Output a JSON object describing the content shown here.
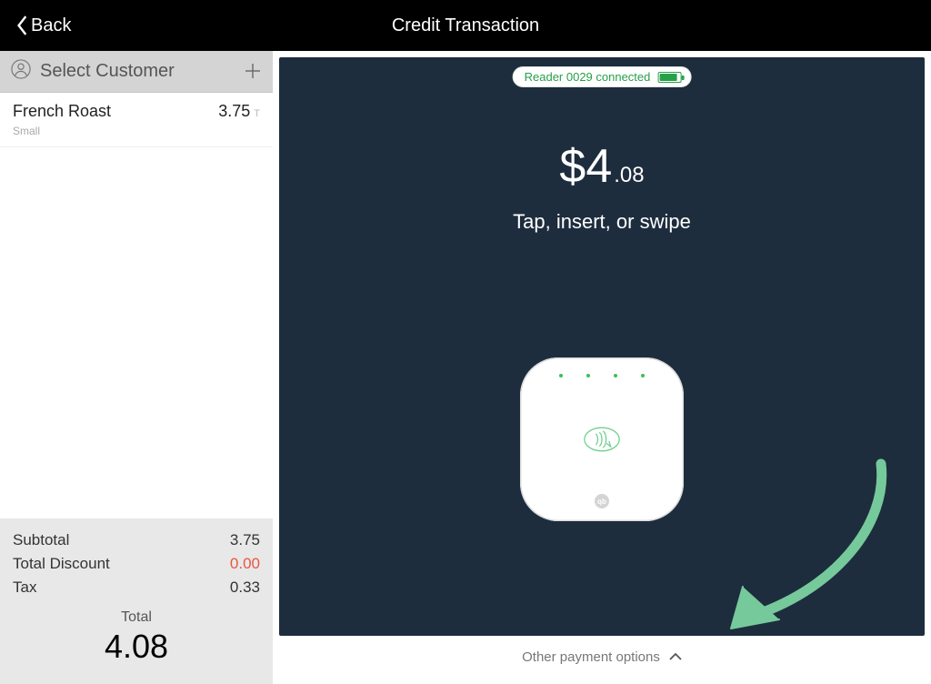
{
  "header": {
    "back_label": "Back",
    "title": "Credit Transaction"
  },
  "customer": {
    "select_label": "Select Customer"
  },
  "items": [
    {
      "name": "French Roast",
      "price": "3.75",
      "tax_flag": "T",
      "variant": "Small"
    }
  ],
  "totals": {
    "subtotal_label": "Subtotal",
    "subtotal_value": "3.75",
    "discount_label": "Total Discount",
    "discount_value": "0.00",
    "tax_label": "Tax",
    "tax_value": "0.33",
    "total_label": "Total",
    "total_value": "4.08"
  },
  "reader": {
    "status_text": "Reader 0029 connected"
  },
  "payment": {
    "currency": "$",
    "whole": "4",
    "cents": ".08",
    "instruction": "Tap, insert, or swipe",
    "other_label": "Other payment options"
  }
}
